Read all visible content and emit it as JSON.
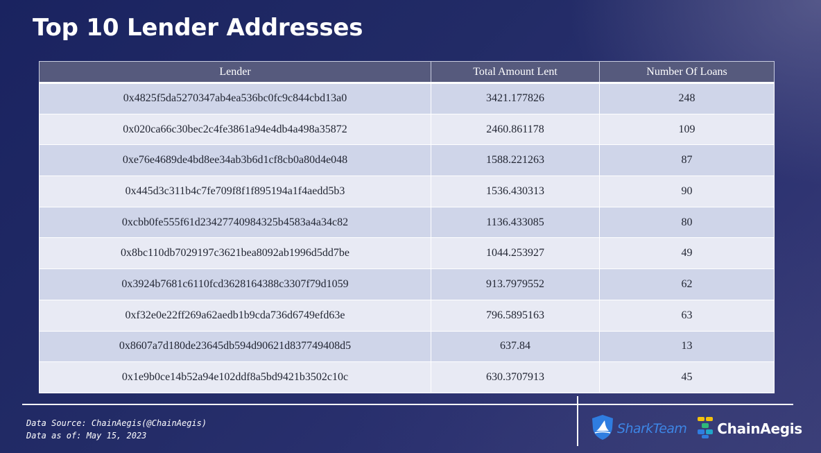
{
  "title": "Top 10 Lender Addresses",
  "table": {
    "headers": [
      "Lender",
      "Total Amount Lent",
      "Number Of Loans"
    ],
    "rows": [
      [
        "0x4825f5da5270347ab4ea536bc0fc9c844cbd13a0",
        "3421.177826",
        "248"
      ],
      [
        "0x020ca66c30bec2c4fe3861a94e4db4a498a35872",
        "2460.861178",
        "109"
      ],
      [
        "0xe76e4689de4bd8ee34ab3b6d1cf8cb0a80d4e048",
        "1588.221263",
        "87"
      ],
      [
        "0x445d3c311b4c7fe709f8f1f895194a1f4aedd5b3",
        "1536.430313",
        "90"
      ],
      [
        "0xcbb0fe555f61d23427740984325b4583a4a34c82",
        "1136.433085",
        "80"
      ],
      [
        "0x8bc110db7029197c3621bea8092ab1996d5dd7be",
        "1044.253927",
        "49"
      ],
      [
        "0x3924b7681c6110fcd3628164388c3307f79d1059",
        "913.7979552",
        "62"
      ],
      [
        "0xf32e0e22ff269a62aedb1b9cda736d6749efd63e",
        "796.5895163",
        "63"
      ],
      [
        "0x8607a7d180de23645db594d90621d837749408d5",
        "637.84",
        "13"
      ],
      [
        "0x1e9b0ce14b52a94e102ddf8a5bd9421b3502c10c",
        "630.3707913",
        "45"
      ]
    ]
  },
  "footer": {
    "source": "Data Source: ChainAegis(@ChainAegis)",
    "date": "Data as of: May 15, 2023",
    "logos": {
      "shark": "SharkTeam",
      "aegis": "ChainAegis"
    }
  },
  "colors": {
    "header_bg": "#565a7d",
    "row_odd": "#cfd5e9",
    "row_even": "#e8eaf4",
    "shark_blue": "#3d86e6"
  },
  "icons": [
    "shark-shield-icon",
    "chainaegis-logo-icon"
  ]
}
